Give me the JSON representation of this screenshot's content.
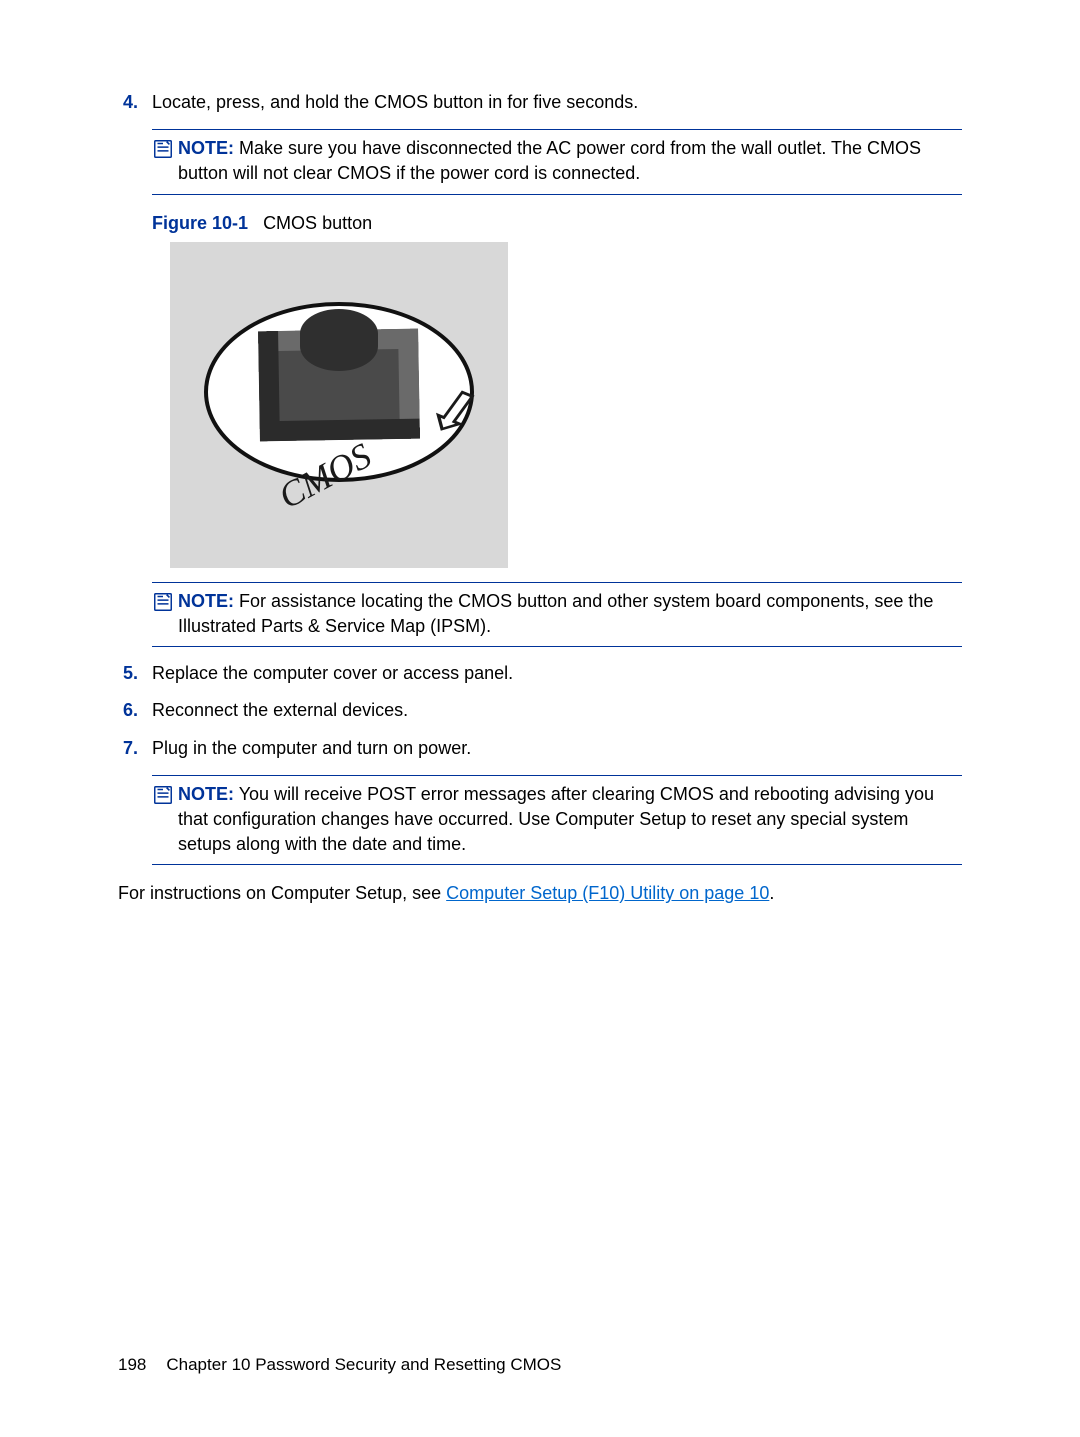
{
  "steps": {
    "s4": {
      "num": "4.",
      "text": "Locate, press, and hold the CMOS button in for five seconds."
    },
    "s5": {
      "num": "5.",
      "text": "Replace the computer cover or access panel."
    },
    "s6": {
      "num": "6.",
      "text": "Reconnect the external devices."
    },
    "s7": {
      "num": "7.",
      "text": "Plug in the computer and turn on power."
    }
  },
  "notes": {
    "label": "NOTE:",
    "n1": "Make sure you have disconnected the AC power cord from the wall outlet. The CMOS button will not clear CMOS if the power cord is connected.",
    "n2": "For assistance locating the CMOS button and other system board components, see the Illustrated Parts & Service Map (IPSM).",
    "n3": "You will receive POST error messages after clearing CMOS and rebooting advising you that configuration changes have occurred. Use Computer Setup to reset any special system setups along with the date and time."
  },
  "figure": {
    "num": "Figure 10-1",
    "caption": "CMOS button",
    "cmos_label": "CMOS"
  },
  "final": {
    "pre": "For instructions on Computer Setup, see ",
    "link": "Computer Setup (F10) Utility on page 10",
    "post": "."
  },
  "footer": {
    "page_num": "198",
    "chapter": "Chapter 10   Password Security and Resetting CMOS"
  }
}
